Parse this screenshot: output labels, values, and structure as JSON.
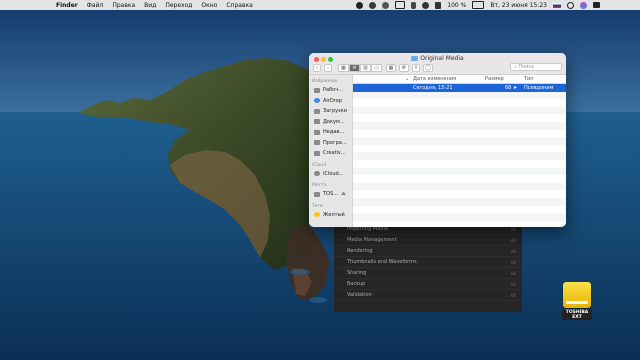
{
  "menubar": {
    "apple": "",
    "items": [
      "Finder",
      "Файл",
      "Правка",
      "Вид",
      "Переход",
      "Окно",
      "Справка"
    ],
    "battery": "100 %",
    "datetime": "Вт, 23 июня 15:23"
  },
  "background_window": {
    "rows": [
      {
        "label": "Importing Media",
        "size": "kB"
      },
      {
        "label": "Media Management",
        "size": "kB"
      },
      {
        "label": "Rendering",
        "size": "kB"
      },
      {
        "label": "Thumbnails and Waveforms",
        "size": "kB"
      },
      {
        "label": "Sharing",
        "size": "kB"
      },
      {
        "label": "Backup",
        "size": "kB"
      },
      {
        "label": "Validation",
        "size": "kB"
      }
    ]
  },
  "finder": {
    "title": "Original Media",
    "search_placeholder": "Поиск",
    "toolbar": {
      "back_icon": "‹",
      "forward_icon": "›",
      "share_icon": "⇪",
      "tag_icon": "◯",
      "gear_icon": "⚙"
    },
    "sidebar": {
      "favorites_header": "Избранное",
      "favorites": [
        "Рабоч…",
        "AirDrop",
        "Загрузки",
        "Докум…",
        "Недав…",
        "Програ…",
        "Creativ…"
      ],
      "icloud_header": "iCloud",
      "icloud": [
        "iCloud…"
      ],
      "places_header": "Места",
      "places": [
        "TOS…"
      ],
      "tags_header": "Теги",
      "tags": [
        "Желтый"
      ]
    },
    "columns": {
      "date": "Дата изменения",
      "size": "Размер",
      "type": "Тип"
    },
    "rows": [
      {
        "name": "",
        "date": "Сегодня, 15:21",
        "size": "68",
        "type": "Псевдоним",
        "selected": true
      }
    ]
  },
  "drive": {
    "label": "TOSHIBA EXT"
  }
}
